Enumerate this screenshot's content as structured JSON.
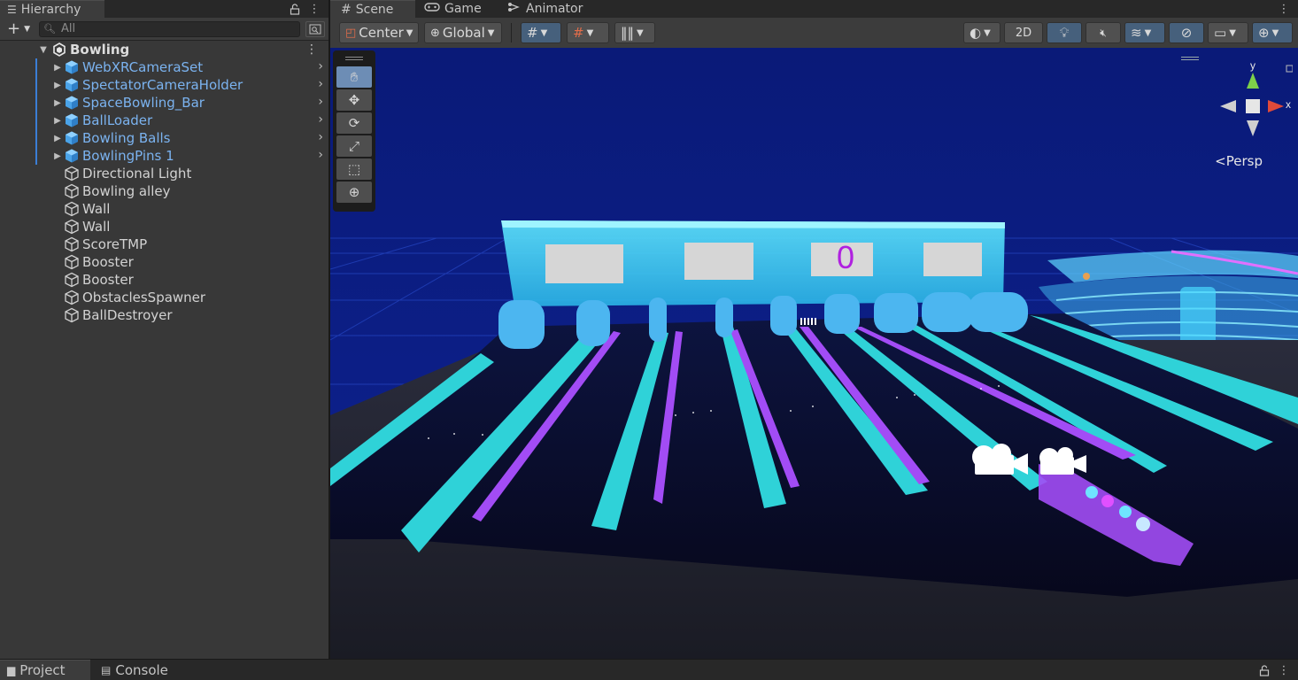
{
  "hierarchy": {
    "tab_label": "Hierarchy",
    "search_placeholder": "All",
    "scene": {
      "name": "Bowling"
    },
    "items": [
      {
        "label": "WebXRCameraSet",
        "type": "prefab"
      },
      {
        "label": "SpectatorCameraHolder",
        "type": "prefab"
      },
      {
        "label": "SpaceBowling_Bar",
        "type": "prefab"
      },
      {
        "label": "BallLoader",
        "type": "prefab"
      },
      {
        "label": "Bowling Balls",
        "type": "prefab"
      },
      {
        "label": "BowlingPins 1",
        "type": "prefab"
      },
      {
        "label": "Directional Light",
        "type": "object"
      },
      {
        "label": "Bowling alley",
        "type": "object"
      },
      {
        "label": "Wall",
        "type": "object"
      },
      {
        "label": "Wall",
        "type": "object"
      },
      {
        "label": "ScoreTMP",
        "type": "object"
      },
      {
        "label": "Booster",
        "type": "object"
      },
      {
        "label": "Booster",
        "type": "object"
      },
      {
        "label": "ObstaclesSpawner",
        "type": "object"
      },
      {
        "label": "BallDestroyer",
        "type": "object"
      }
    ]
  },
  "scene_window": {
    "tabs": [
      {
        "label": "Scene",
        "icon": "grid-icon"
      },
      {
        "label": "Game",
        "icon": "gamepad-icon"
      },
      {
        "label": "Animator",
        "icon": "animator-icon"
      }
    ],
    "toolbar": {
      "pivot": "Center",
      "space": "Global",
      "mode_2d": "2D"
    },
    "score_text": "0",
    "projection_label": "Persp",
    "gizmo_axes": {
      "x": "x",
      "y": "y"
    }
  },
  "bottom": {
    "tabs": [
      {
        "label": "Project",
        "icon": "folder-icon"
      },
      {
        "label": "Console",
        "icon": "console-icon"
      }
    ]
  },
  "colors": {
    "prefab_text": "#7bb3f0",
    "lane_cyan": "#2fd2d8",
    "lane_purple": "#a24cf5",
    "sky_blue": "#0b1c7a",
    "score_purple": "#b020e0"
  }
}
